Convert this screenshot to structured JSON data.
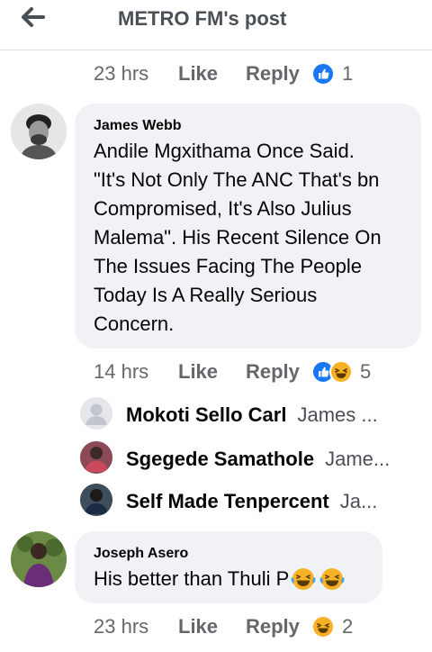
{
  "header": {
    "title": "METRO FM's post",
    "back_icon": "arrow-left-icon"
  },
  "action_labels": {
    "like": "Like",
    "reply": "Reply"
  },
  "colors": {
    "like_blue": "#1877f2",
    "haha_yellow": "#f7b125",
    "bubble_bg": "#f0f2f5",
    "meta_text": "#65676b"
  },
  "top_actions": {
    "time": "23 hrs",
    "reaction_count": "1",
    "reactions": [
      "like"
    ]
  },
  "comments": [
    {
      "author": "James Webb",
      "text": "Andile Mgxithama Once Said. \"It's Not Only The ANC That's bn Compromised, It's Also Julius Malema\". His Recent Silence On The Issues Facing The People Today Is A Really Serious Concern.",
      "lines": [
        "Andile Mgxithama Once Said.",
        "\"It's Not Only The ANC That's bn",
        "Compromised, It's Also Julius",
        "Malema\". His Recent Silence On",
        "The Issues Facing The People",
        "Today Is A Really Serious",
        "Concern."
      ],
      "time": "14 hrs",
      "reaction_count": "5",
      "reactions": [
        "like",
        "haha"
      ],
      "replies": [
        {
          "name": "Mokoti Sello Carl",
          "snippet": "James ..."
        },
        {
          "name": "Sgegede Samathole",
          "snippet": "Jame..."
        },
        {
          "name": "Self Made Tenpercent",
          "snippet": "Ja..."
        }
      ]
    },
    {
      "author": "Joseph Asero",
      "text": "His better than Thuli P",
      "emojis": [
        "face-with-tears-of-joy",
        "face-with-tears-of-joy"
      ],
      "time": "23 hrs",
      "reaction_count": "2",
      "reactions": [
        "haha"
      ]
    }
  ]
}
